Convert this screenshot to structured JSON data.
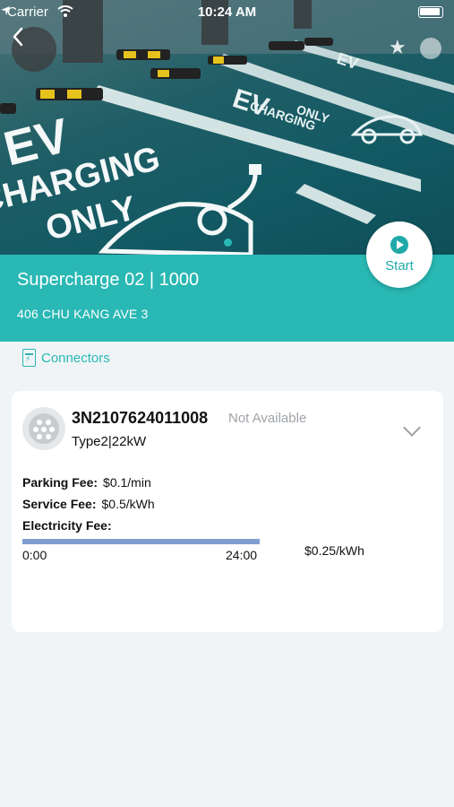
{
  "status_bar": {
    "carrier": "Carrier",
    "time": "10:24 AM"
  },
  "hero": {
    "image_alt": "EV charging parking bays",
    "painted_text": [
      "EV",
      "CHARGING",
      "ONLY"
    ]
  },
  "icons": {
    "back": "chevron-left-icon",
    "favorite": "star-icon",
    "more": "more-icon",
    "start": "play-icon",
    "connectors": "charger-icon",
    "plug": "type2-plug-icon",
    "expand": "chevron-down-icon"
  },
  "station": {
    "title": "Supercharge 02 | 1000",
    "address": "406 CHU KANG AVE 3"
  },
  "start_button": {
    "label": "Start"
  },
  "connectors": {
    "header": "Connectors",
    "items": [
      {
        "id": "3N2107624011008",
        "status": "Not Available",
        "type": "Type2|22kW",
        "parking_fee_label": "Parking Fee:",
        "parking_fee": "$0.1/min",
        "service_fee_label": "Service Fee:",
        "service_fee": "$0.5/kWh",
        "electricity_fee_label": "Electricity Fee:",
        "tariff": {
          "start": "0:00",
          "end": "24:00",
          "rate": "$0.25/kWh"
        }
      }
    ]
  },
  "colors": {
    "teal": "#29b8b4",
    "tariff_bar": "#7f9fd0",
    "background": "#f0f4f6"
  }
}
